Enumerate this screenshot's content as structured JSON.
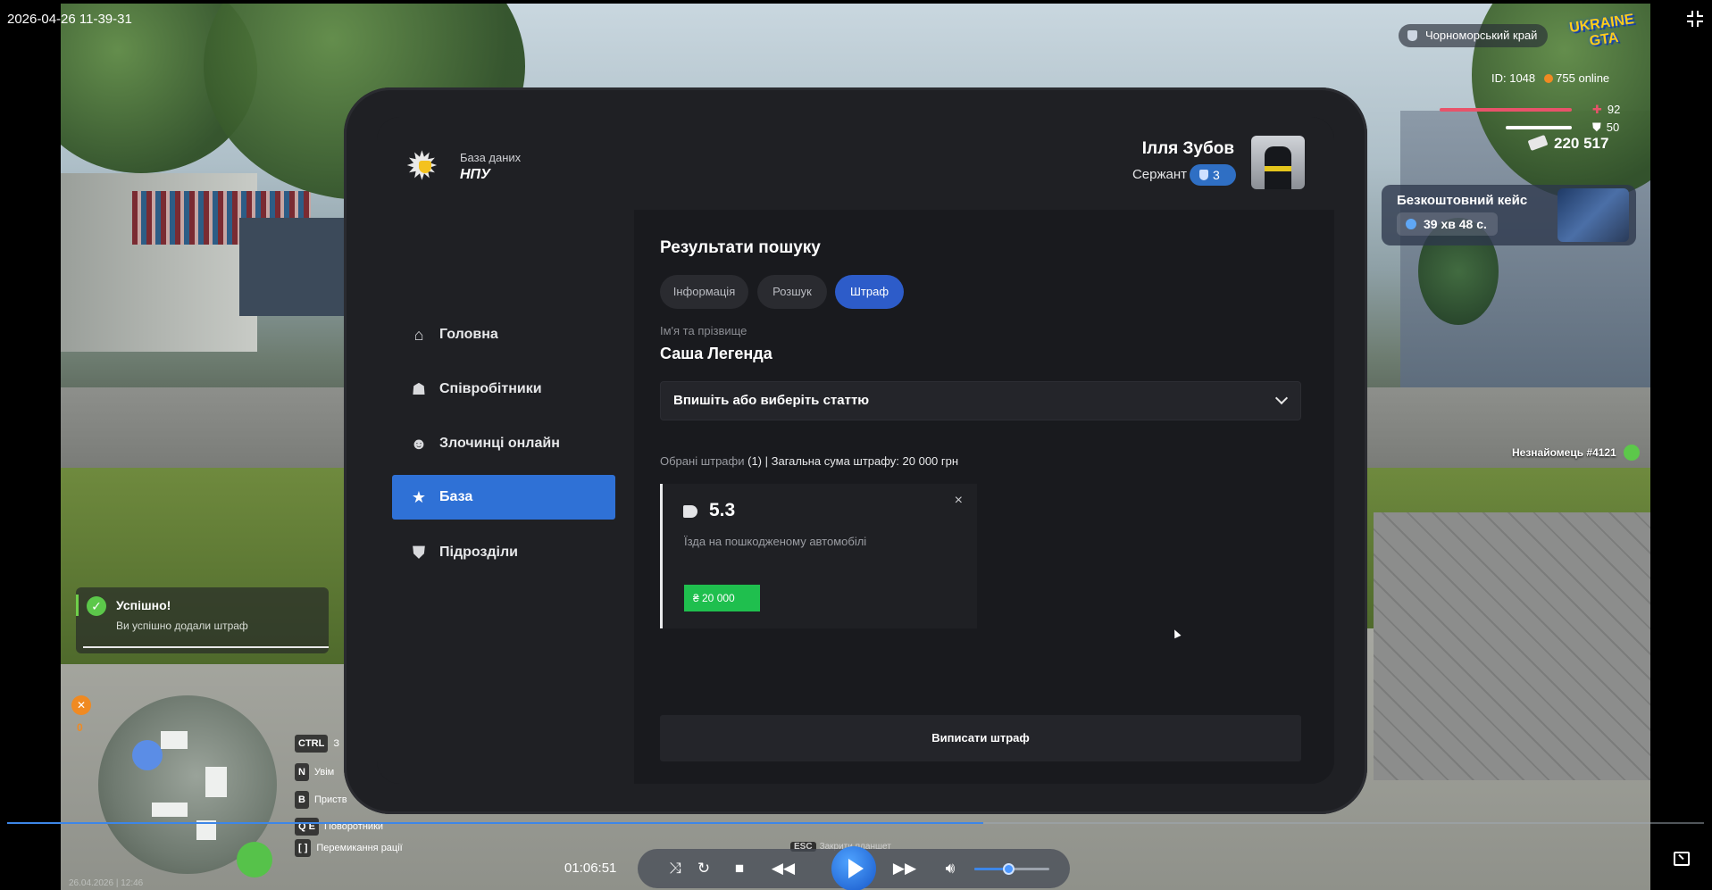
{
  "overlay": {
    "timestamp": "2026-04-26 11-39-31",
    "date_footer": "26.04.2026 | 12:46"
  },
  "hud": {
    "region": "Чорноморський край",
    "logo_top": "UKRAINE",
    "logo_bottom": "GTA",
    "player_id": "ID: 1048",
    "online": "755 online",
    "health": "92",
    "armor": "50",
    "money": "220 517",
    "free_case": {
      "title": "Безкоштовний кейс",
      "timer": "39 хв 48 с."
    },
    "stranger": "Незнайомець #4121",
    "toast": {
      "title": "Успішно!",
      "message": "Ви успішно додали штраф"
    },
    "coin_count": "0",
    "key_hints": [
      {
        "key": "CTRL",
        "label": "З"
      },
      {
        "key": "N",
        "label": "Увім"
      },
      {
        "key": "B",
        "label": "Приств"
      },
      {
        "key": "Q E",
        "label": "Поворотники"
      },
      {
        "key": "[ ]",
        "label": "Перемикання рації"
      }
    ],
    "esc_hint": {
      "key": "ESC",
      "label": "Закрити планшет"
    },
    "colors": {
      "health": "#e8536a",
      "armor": "#ffffff",
      "accent": "#2f71d6",
      "success": "#1fbf4e"
    }
  },
  "tablet": {
    "brand": {
      "line1": "База даних",
      "line2": "НПУ"
    },
    "nav": [
      {
        "label": "Головна",
        "icon": "home-icon",
        "active": false
      },
      {
        "label": "Співробітники",
        "icon": "users-icon",
        "active": false
      },
      {
        "label": "Злочинці онлайн",
        "icon": "criminal-icon",
        "active": false
      },
      {
        "label": "База",
        "icon": "star-icon",
        "active": true
      },
      {
        "label": "Підрозділи",
        "icon": "shield-icon",
        "active": false
      }
    ],
    "user": {
      "name": "Ілля Зубов",
      "rank": "Сержант",
      "rank_level": "3"
    },
    "results_title": "Результати пошуку",
    "tabs": [
      {
        "label": "Інформація",
        "active": false
      },
      {
        "label": "Розшук",
        "active": false
      },
      {
        "label": "Штраф",
        "active": true
      }
    ],
    "name_label": "Ім'я та прізвище",
    "name_value": "Саша Легенда",
    "article_select": {
      "placeholder": "Впишіть або виберіть статтю"
    },
    "fines_summary": {
      "prefix": "Обрані штрафи",
      "count": "(1)",
      "rest": "| Загальна сума штрафу: 20 000 грн"
    },
    "fine_card": {
      "code": "5.3",
      "description": "Їзда на пошкодженому автомобілі",
      "amount": "₴ 20 000",
      "close": "×"
    },
    "issue_button": "Виписати штраф"
  },
  "player": {
    "time": "01:06:51",
    "progress": 0.575,
    "volume": 0.45
  }
}
